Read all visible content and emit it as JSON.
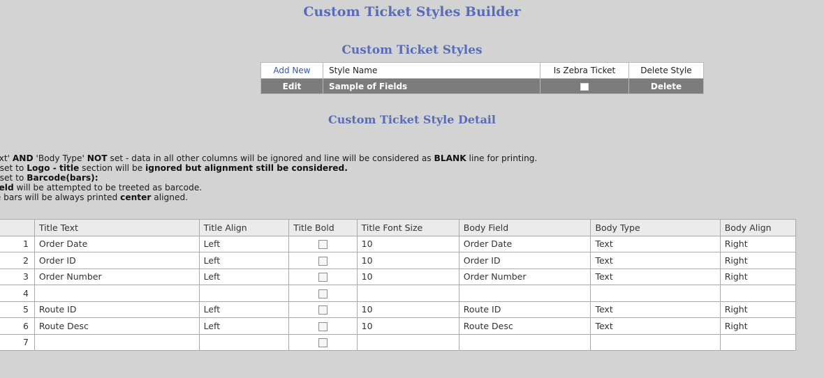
{
  "page": {
    "title": "Custom Ticket Styles Builder",
    "styles_title": "Custom Ticket Styles",
    "detail_title": "Custom Ticket Style Detail"
  },
  "styles_table": {
    "add_new": "Add New",
    "col_style_name": "Style Name",
    "col_is_zebra": "Is Zebra Ticket",
    "col_delete": "Delete Style",
    "row": {
      "edit": "Edit",
      "name": "Sample of Fields",
      "zebra": false,
      "delete": "Delete"
    }
  },
  "notes": {
    "l1a": "Text' ",
    "l1b": "AND",
    "l1c": " 'Body Type' ",
    "l1d": "NOT",
    "l1e": " set - data in all other columns will be ignored and line will be considered as ",
    "l1f": "BLANK",
    "l1g": " line for printing.",
    "l2a": " is set to ",
    "l2b": "Logo - title",
    "l2c": " section will be ",
    "l2d": "ignored but alignment still be considered.",
    "l3a": " is set to ",
    "l3b": "Barcode(bars):",
    "l4a": "Field",
    "l4b": " will be attempted to be treeted as barcode.",
    "l5a": "de bars will be always printed ",
    "l5b": "center",
    "l5c": " aligned."
  },
  "grid": {
    "headers": [
      "",
      "Title Text",
      "Title Align",
      "Title Bold",
      "Title Font Size",
      "Body Field",
      "Body Type",
      "Body Align"
    ],
    "rows": [
      {
        "n": "1",
        "title_text": "Order Date",
        "align": "Left",
        "bold": false,
        "size": "10",
        "body_field": "Order Date",
        "body_type": "Text",
        "body_align": "Right"
      },
      {
        "n": "2",
        "title_text": "Order ID",
        "align": "Left",
        "bold": false,
        "size": "10",
        "body_field": "Order ID",
        "body_type": "Text",
        "body_align": "Right"
      },
      {
        "n": "3",
        "title_text": "Order Number",
        "align": "Left",
        "bold": false,
        "size": "10",
        "body_field": "Order Number",
        "body_type": "Text",
        "body_align": "Right"
      },
      {
        "n": "4",
        "title_text": "",
        "align": "",
        "bold": false,
        "size": "",
        "body_field": "",
        "body_type": "",
        "body_align": ""
      },
      {
        "n": "5",
        "title_text": "Route ID",
        "align": "Left",
        "bold": false,
        "size": "10",
        "body_field": "Route ID",
        "body_type": "Text",
        "body_align": "Right"
      },
      {
        "n": "6",
        "title_text": "Route Desc",
        "align": "Left",
        "bold": false,
        "size": "10",
        "body_field": "Route Desc",
        "body_type": "Text",
        "body_align": "Right"
      },
      {
        "n": "7",
        "title_text": "",
        "align": "",
        "bold": false,
        "size": "",
        "body_field": "",
        "body_type": "",
        "body_align": ""
      }
    ]
  }
}
